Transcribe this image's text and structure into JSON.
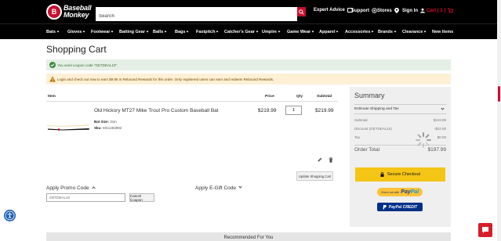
{
  "header": {
    "logo_text_line1": "Baseball",
    "logo_text_line2": "Monkey",
    "search_placeholder": "Search",
    "expert_advice": "Expert Advice",
    "support": "Support",
    "stores": "Stores",
    "sign_in": "Sign In",
    "cart": "Cart ( 1 )"
  },
  "nav": {
    "items": [
      "Bats",
      "Gloves",
      "Footwear",
      "Batting Gear",
      "Balls",
      "Bags",
      "Fastpitch",
      "Catcher's Gear",
      "Umpire",
      "Game Wear",
      "Apparel",
      "Accessories",
      "Brands",
      "Clearance",
      "New Items"
    ]
  },
  "page": {
    "title": "Shopping Cart",
    "success_message": "You used coupon code \"GETDEAL10\".",
    "warning_message": "Login and check out now to earn $9.95 in Rebound Rewards for this order. Only registered users can earn and redeem Rebound Rewards."
  },
  "cart": {
    "headers": {
      "item": "Item",
      "price": "Price",
      "qty": "Qty",
      "subtotal": "Subtotal"
    },
    "item": {
      "name": "Old Hickory MT27 Mike Trout Pro Custom Baseball Bat",
      "price": "$219.99",
      "qty": "1",
      "subtotal": "$219.99",
      "bat_size_label": "Bat Size:",
      "bat_size_value": "31in",
      "sku_label": "Sku:",
      "sku_value": "MS1483892"
    },
    "update_button": "Update Shopping Cart",
    "promo_title": "Apply Promo Code",
    "promo_value": "GETDEAL10",
    "cancel_coupon": "Cancel Coupon",
    "egift_title": "Apply E-Gift Code"
  },
  "summary": {
    "title": "Summary",
    "estimate_label": "Estimate Shipping and Tax",
    "subtotal_label": "Subtotal",
    "subtotal_value": "$219.99",
    "discount_label": "Discount (GETDEAL10)",
    "discount_value": "-$22.00",
    "tax_label": "Tax",
    "tax_value": "$0.00",
    "order_total_label": "Order Total",
    "order_total_value": "$197.99",
    "checkout_button": "Secure Checkout",
    "paypal_checkout_prefix": "Check out with",
    "paypal_credit": "PayPal CREDIT"
  },
  "recommended": {
    "title": "Recommended For You"
  },
  "colors": {
    "brand_red": "#c8102e",
    "checkout_yellow": "#f4c515",
    "paypal_blue": "#003087"
  }
}
